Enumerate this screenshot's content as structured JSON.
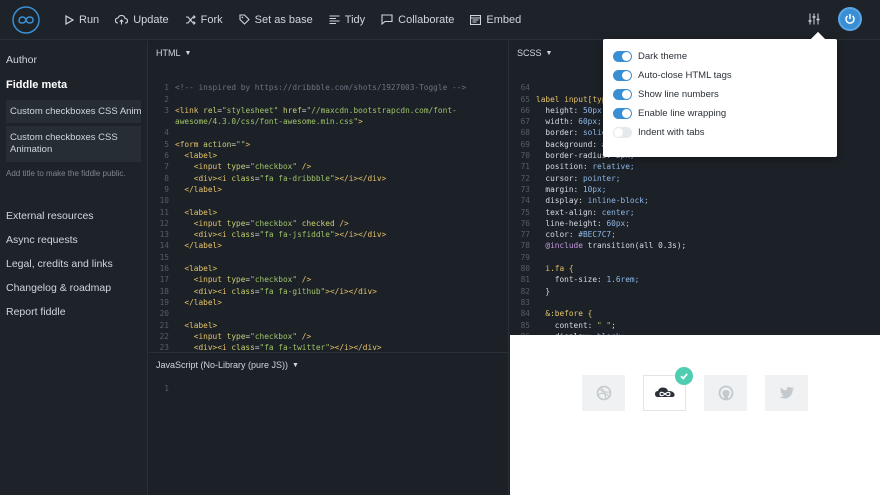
{
  "toolbar": {
    "run": "Run",
    "update": "Update",
    "fork": "Fork",
    "set_as_base": "Set as base",
    "tidy": "Tidy",
    "collaborate": "Collaborate",
    "embed": "Embed"
  },
  "sidebar": {
    "author": "Author",
    "fiddle_meta": "Fiddle meta",
    "title_value": "Custom checkboxes CSS Animation",
    "description_value": "Custom checkboxes CSS Animation",
    "hint": "Add title to make the fiddle public.",
    "links": [
      "External resources",
      "Async requests",
      "Legal, credits and links",
      "Changelog & roadmap",
      "Report fiddle"
    ]
  },
  "panes": {
    "html_label": "HTML",
    "js_label": "JavaScript (No-Library (pure JS))",
    "scss_label": "SCSS"
  },
  "settings": {
    "options": [
      {
        "label": "Dark theme",
        "on": true
      },
      {
        "label": "Auto-close HTML tags",
        "on": true
      },
      {
        "label": "Show line numbers",
        "on": true
      },
      {
        "label": "Enable line wrapping",
        "on": true
      },
      {
        "label": "Indent with tabs",
        "on": false
      }
    ]
  },
  "colors": {
    "accent": "#3a8fd4",
    "check": "#4ecdb0"
  },
  "js_line": "1"
}
